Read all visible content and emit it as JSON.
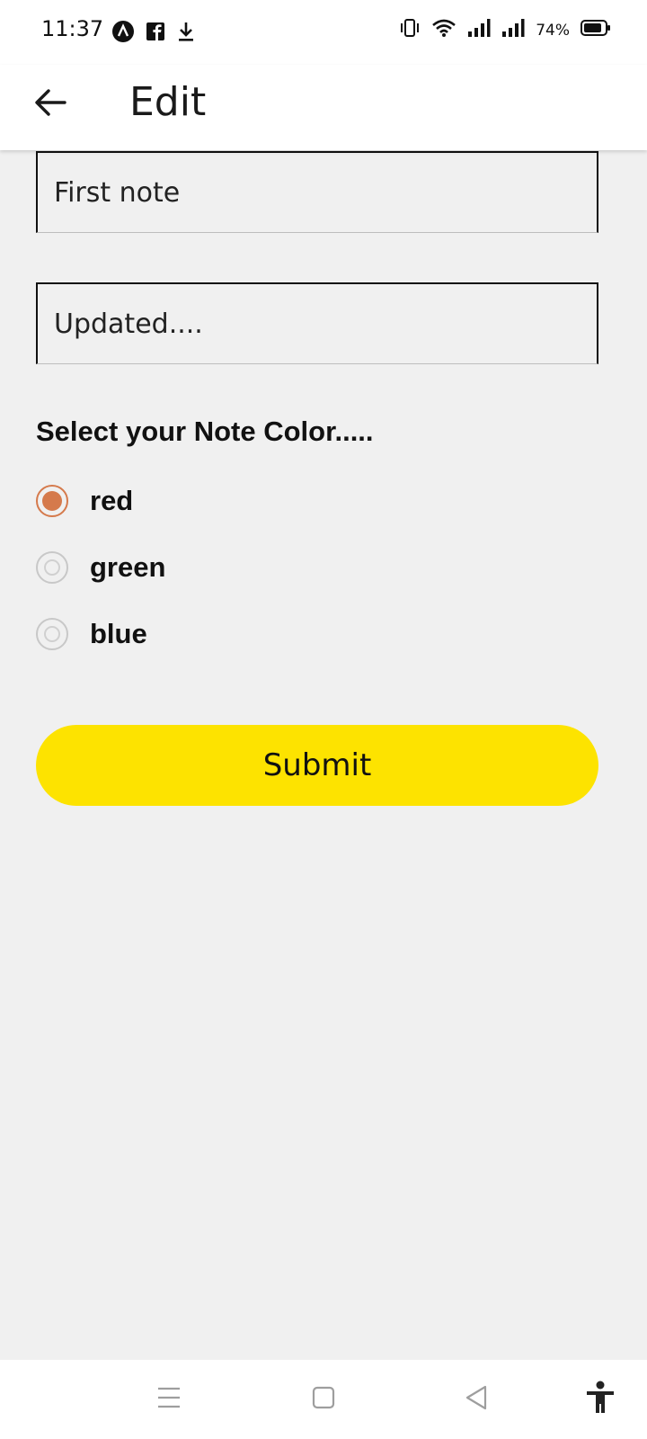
{
  "status_bar": {
    "time": "11:37",
    "battery_percent": "74%",
    "left_icons": [
      "app-notification-icon",
      "facebook-icon",
      "download-icon"
    ],
    "right_icons": [
      "vibrate-icon",
      "wifi-icon",
      "signal-icon",
      "signal-icon",
      "battery-icon"
    ]
  },
  "app_bar": {
    "title": "Edit",
    "back_icon": "arrow-left-icon"
  },
  "form": {
    "title_value": "First note",
    "body_value": "Updated....",
    "color_prompt": "Select your Note Color.....",
    "color_options": [
      {
        "label": "red",
        "selected": true
      },
      {
        "label": "green",
        "selected": false
      },
      {
        "label": "blue",
        "selected": false
      }
    ],
    "submit_label": "Submit"
  },
  "colors": {
    "accent_radio": "#d57a4c",
    "submit_bg": "#fde300",
    "page_bg": "#f0f0f0"
  },
  "nav_bar": {
    "icons": [
      "menu-icon",
      "home-square-icon",
      "back-triangle-icon",
      "accessibility-icon"
    ]
  }
}
